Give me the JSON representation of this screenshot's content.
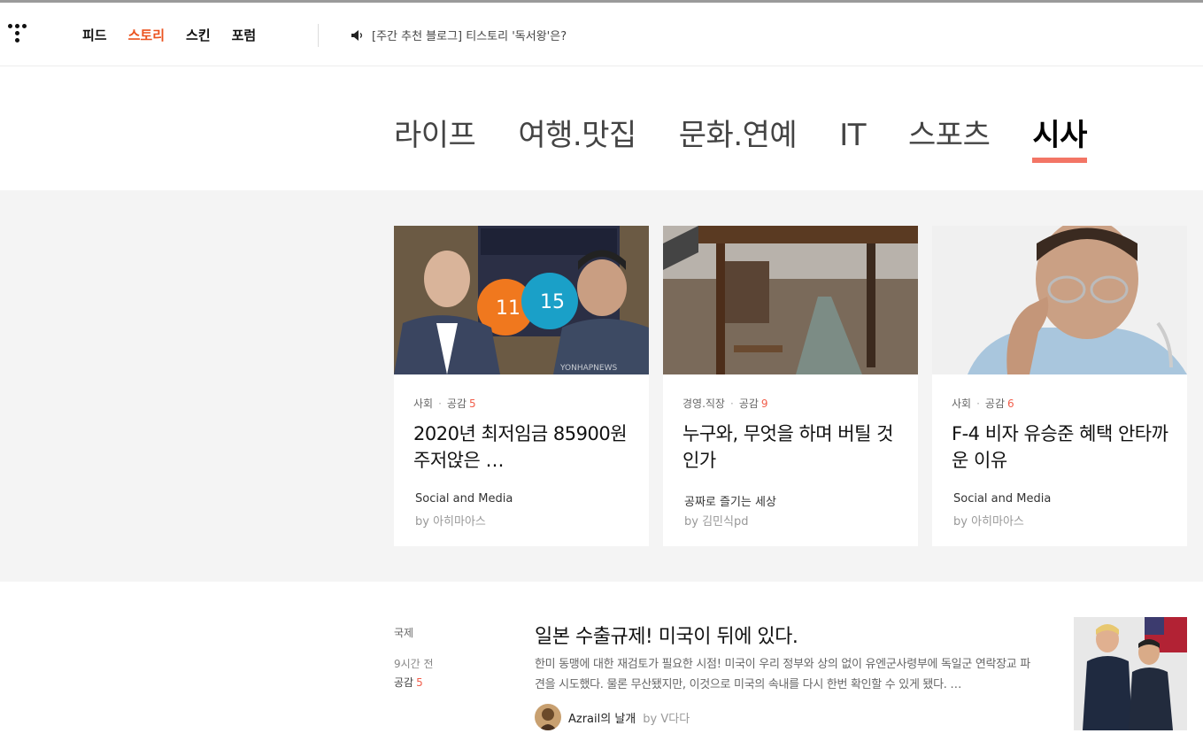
{
  "header": {
    "nav": [
      {
        "label": "피드",
        "active": false
      },
      {
        "label": "스토리",
        "active": true
      },
      {
        "label": "스킨",
        "active": false
      },
      {
        "label": "포럼",
        "active": false
      }
    ],
    "notice": "[주간 추천 블로그] 티스토리 '독서왕'은?"
  },
  "categories": [
    "라이프",
    "여행.맛집",
    "문화.연예",
    "IT",
    "스포츠",
    "시사"
  ],
  "active_category": "시사",
  "cards": [
    {
      "category": "사회",
      "like_label": "공감",
      "like_count": "5",
      "title": "2020년 최저임금 85900원 주저앉은 …",
      "blog": "Social and Media",
      "by": "by 아히마아스",
      "image_watermark": "YONHAPNEWS"
    },
    {
      "category": "경영.직장",
      "like_label": "공감",
      "like_count": "9",
      "title": "누구와, 무엇을 하며 버틸 것인가",
      "blog": "공짜로 즐기는 세상",
      "by": "by 김민식pd"
    },
    {
      "category": "사회",
      "like_label": "공감",
      "like_count": "6",
      "title": "F-4 비자 유승준 혜택 안타까운 이유",
      "blog": "Social and Media",
      "by": "by 아히마아스"
    }
  ],
  "article": {
    "category": "국제",
    "time": "9시간 전",
    "like_label": "공감",
    "like_count": "5",
    "title": "일본 수출규제! 미국이 뒤에 있다.",
    "description": "한미 동맹에 대한 재검토가 필요한 시점! 미국이 우리 정부와 상의 없이 유엔군사령부에 독일군 연락장교 파견을 시도했다. 물론 무산됐지만, 이것으로 미국의 속내를 다시 한번 확인할 수 있게 됐다. …",
    "blog": "Azrail의 날개",
    "by": "by V다다"
  },
  "colors": {
    "accent": "#eb531f",
    "underline": "#f15d4a",
    "band": "#f4f4f4"
  }
}
